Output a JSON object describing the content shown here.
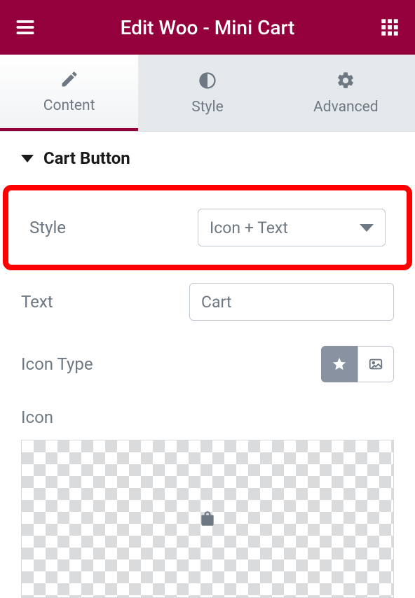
{
  "header": {
    "title": "Edit Woo - Mini Cart"
  },
  "tabs": [
    {
      "label": "Content",
      "active": true
    },
    {
      "label": "Style",
      "active": false
    },
    {
      "label": "Advanced",
      "active": false
    }
  ],
  "section": {
    "title": "Cart Button"
  },
  "fields": {
    "style_label": "Style",
    "style_value": "Icon + Text",
    "text_label": "Text",
    "text_value": "Cart",
    "icon_type_label": "Icon Type",
    "icon_label": "Icon"
  }
}
